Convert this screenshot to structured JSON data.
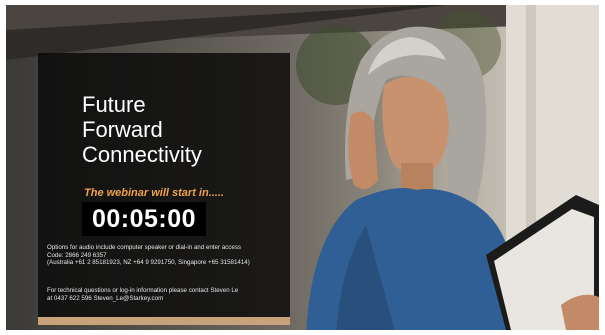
{
  "title_lines": [
    "Future",
    "Forward",
    "Connectivity"
  ],
  "subtitle": "The webinar will start in.....",
  "countdown": "00:05:00",
  "audio_info": [
    "Options for audio include computer speaker or dial-in and enter access",
    "Code: 2866 249 6357",
    "(Australia +61 2 85181923, NZ +64 9 9291750, Singapore +65 31581414)"
  ],
  "contact_info": [
    "For technical questions or log-in information please contact Steven Le",
    "at 0437 622 596   Steven_Le@Starkey.com"
  ],
  "colors": {
    "accent": "#f2a24a",
    "panel": "#080808",
    "text": "#ffffff"
  }
}
